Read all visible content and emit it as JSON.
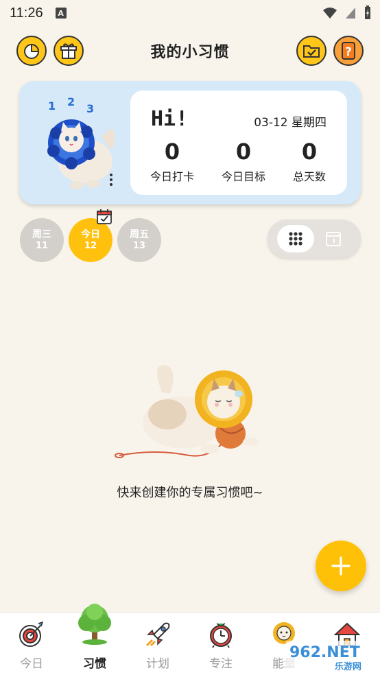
{
  "status": {
    "time": "11:26",
    "badge_letter": "A"
  },
  "header": {
    "title": "我的小习惯",
    "buttons": [
      {
        "name": "stats-button",
        "icon": "pie-chart-icon"
      },
      {
        "name": "gift-button",
        "icon": "gift-icon"
      },
      {
        "name": "folder-button",
        "icon": "folder-check-icon"
      },
      {
        "name": "help-button",
        "icon": "question-icon"
      }
    ]
  },
  "summary": {
    "greeting": "Hi!",
    "date": "03-12 星期四",
    "stats": [
      {
        "value": "0",
        "label": "今日打卡"
      },
      {
        "value": "0",
        "label": "今日目标"
      },
      {
        "value": "0",
        "label": "总天数"
      }
    ]
  },
  "days": [
    {
      "name": "周三",
      "num": "11",
      "active": false
    },
    {
      "name": "今日",
      "num": "12",
      "active": true
    },
    {
      "name": "周五",
      "num": "13",
      "active": false
    }
  ],
  "empty": {
    "message": "快来创建你的专属习惯吧~"
  },
  "nav": [
    {
      "label": "今日",
      "icon": "target-icon",
      "active": false
    },
    {
      "label": "习惯",
      "icon": "tree-icon",
      "active": true
    },
    {
      "label": "计划",
      "icon": "rocket-icon",
      "active": false
    },
    {
      "label": "专注",
      "icon": "alarm-clock-icon",
      "active": false
    },
    {
      "label": "能量",
      "icon": "sunflower-icon",
      "active": false
    },
    {
      "label": "",
      "icon": "house-icon",
      "active": false
    }
  ],
  "watermark": {
    "text": "962.NET",
    "subtext": "乐游网"
  },
  "colors": {
    "accent": "#ffc10d",
    "hero_bg": "#d5e9f8",
    "page_bg": "#f8f4ec",
    "inactive_day": "#d3d0cb"
  }
}
